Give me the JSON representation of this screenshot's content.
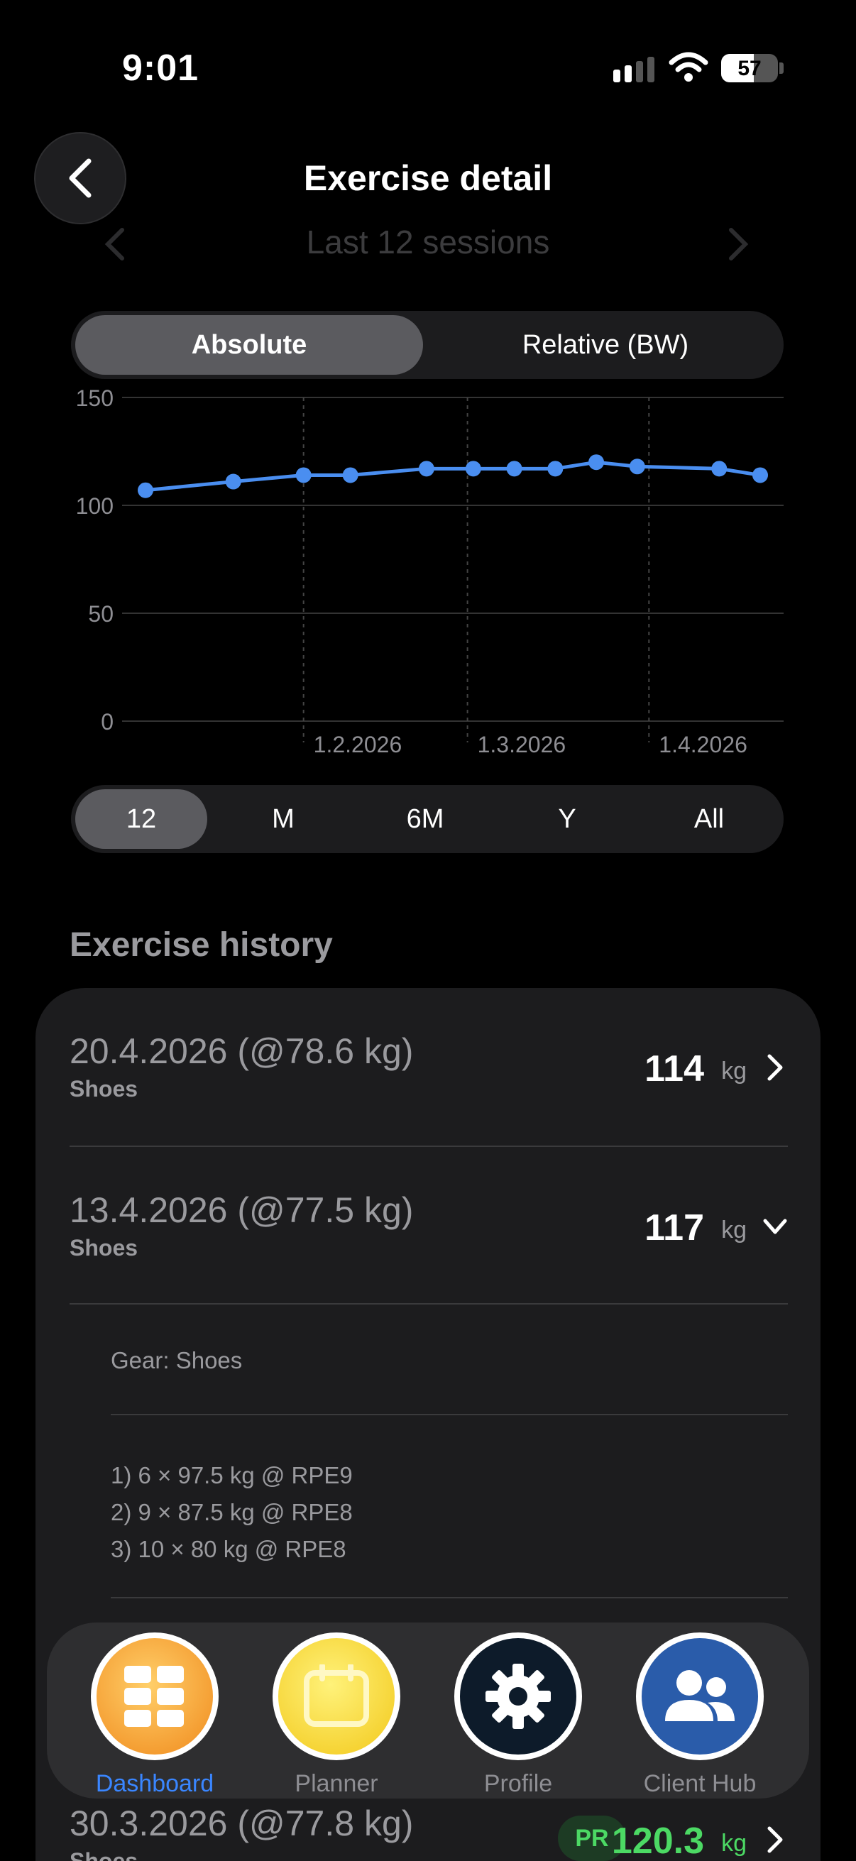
{
  "status_bar": {
    "time": "9:01",
    "battery": "57",
    "battery_level": 0.57
  },
  "header": {
    "title": "Exercise detail",
    "subtitle": "Last 12 sessions"
  },
  "mode_toggle": {
    "options": [
      "Absolute",
      "Relative (BW)"
    ],
    "selected": "Absolute"
  },
  "chart_data": {
    "type": "line",
    "x": [
      "2026-01-05",
      "2026-01-20",
      "2026-02-01",
      "2026-02-09",
      "2026-02-22",
      "2026-03-02",
      "2026-03-09",
      "2026-03-16",
      "2026-03-23",
      "2026-03-30",
      "2026-04-13",
      "2026-04-20"
    ],
    "values": [
      107,
      111,
      114,
      114,
      117,
      117,
      117,
      117,
      120,
      118,
      117,
      114
    ],
    "ylim": [
      0,
      150
    ],
    "yticks": [
      0,
      50,
      100,
      150
    ],
    "xticks": [
      "1.2.2026",
      "1.3.2026",
      "1.4.2026"
    ],
    "grid": true,
    "line_color": "#4a8ef0"
  },
  "range_selector": {
    "options": [
      "12",
      "M",
      "6M",
      "Y",
      "All"
    ],
    "selected": "12"
  },
  "history": {
    "title": "Exercise history",
    "unit": "kg",
    "entries": [
      {
        "date": "20.4.2026 (@78.6 kg)",
        "gear": "Shoes",
        "value": "114"
      },
      {
        "date": "13.4.2026 (@77.5 kg)",
        "gear": "Shoes",
        "value": "117",
        "details": {
          "gear": "Gear: Shoes",
          "sets": [
            "1) 6 × 97.5 kg @ RPE9",
            "2) 9 × 87.5 kg @ RPE8",
            "3) 10 × 80 kg @ RPE8"
          ]
        }
      },
      {
        "date": "30.3.2026 (@77.8 kg)",
        "gear": "Shoes",
        "value": "120.3",
        "badge": "PR"
      }
    ]
  },
  "tabbar": {
    "tabs": [
      {
        "label": "Dashboard",
        "icon": "grid-icon",
        "color": "#f5a43a"
      },
      {
        "label": "Planner",
        "icon": "calendar-icon",
        "color": "#f7d52b"
      },
      {
        "label": "Profile",
        "icon": "gear-icon",
        "color": "#0d1b2a"
      },
      {
        "label": "Client Hub",
        "icon": "people-icon",
        "color": "#2a5caa"
      }
    ],
    "active": "Dashboard"
  }
}
